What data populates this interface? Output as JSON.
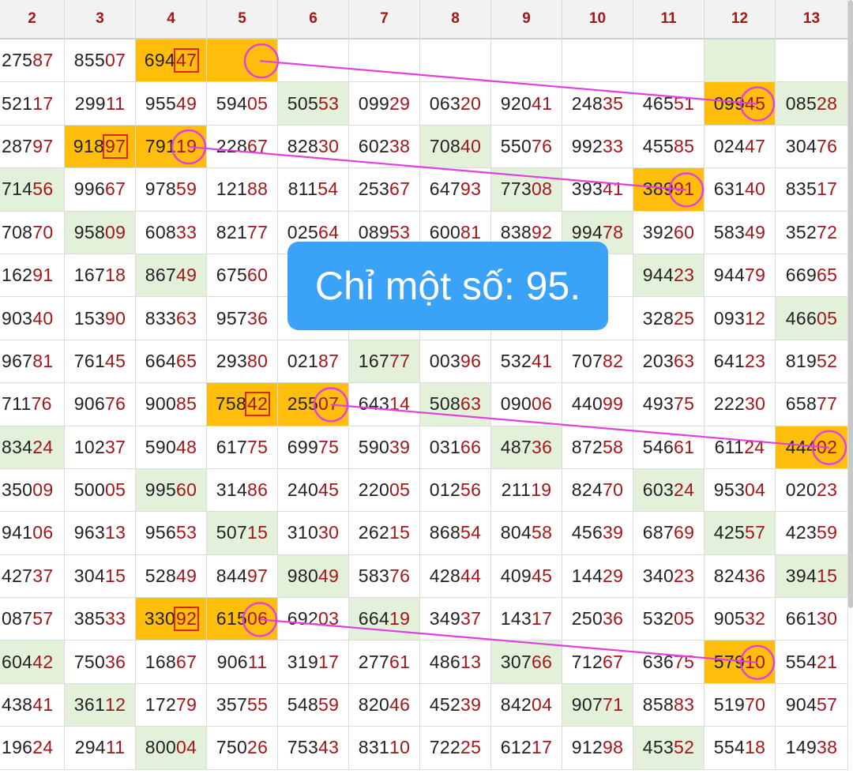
{
  "headers": [
    "2",
    "3",
    "4",
    "5",
    "6",
    "7",
    "8",
    "9",
    "10",
    "11",
    "12",
    "13"
  ],
  "rows": [
    [
      "27587",
      "85507",
      "69447",
      "",
      "",
      "",
      "",
      "",
      "",
      "",
      "",
      ""
    ],
    [
      "52117",
      "29911",
      "95549",
      "59405",
      "50553",
      "09929",
      "06320",
      "92041",
      "24835",
      "46551",
      "09945",
      "08528"
    ],
    [
      "28797",
      "91897",
      "79119",
      "22867",
      "82830",
      "60238",
      "70840",
      "55076",
      "99233",
      "45585",
      "02447",
      "30476"
    ],
    [
      "71456",
      "99667",
      "97859",
      "12188",
      "81154",
      "25367",
      "64793",
      "77308",
      "39341",
      "38991",
      "63140",
      "83517"
    ],
    [
      "70870",
      "95809",
      "60833",
      "82177",
      "02564",
      "08953",
      "60081",
      "83892",
      "99478",
      "39260",
      "58349",
      "35272"
    ],
    [
      "16291",
      "16718",
      "86749",
      "67560",
      "",
      "",
      "",
      "",
      "84",
      "94423",
      "94479",
      "66965"
    ],
    [
      "90340",
      "15390",
      "83363",
      "95736",
      "",
      "",
      "",
      "",
      "86",
      "32825",
      "09312",
      "46605"
    ],
    [
      "96781",
      "76145",
      "66465",
      "29380",
      "02187",
      "16777",
      "00396",
      "53241",
      "70782",
      "20363",
      "64123",
      "81952"
    ],
    [
      "71176",
      "90676",
      "90085",
      "75842",
      "25507",
      "64314",
      "50863",
      "09006",
      "44099",
      "49375",
      "22230",
      "65877"
    ],
    [
      "83424",
      "10237",
      "59048",
      "61775",
      "69975",
      "59039",
      "03166",
      "48736",
      "87258",
      "54661",
      "61124",
      "44402"
    ],
    [
      "35009",
      "50005",
      "99560",
      "31486",
      "24045",
      "22005",
      "01256",
      "21119",
      "82470",
      "60324",
      "95304",
      "02023"
    ],
    [
      "94106",
      "96313",
      "95653",
      "50715",
      "31030",
      "26215",
      "86854",
      "80458",
      "45639",
      "68769",
      "42557",
      "42359"
    ],
    [
      "42737",
      "30415",
      "52849",
      "84497",
      "98049",
      "58376",
      "42844",
      "40945",
      "14429",
      "34023",
      "82436",
      "39415"
    ],
    [
      "08757",
      "38533",
      "33092",
      "61506",
      "69203",
      "66419",
      "34937",
      "14317",
      "25036",
      "53205",
      "90532",
      "66130"
    ],
    [
      "60442",
      "75036",
      "16867",
      "90611",
      "31917",
      "27761",
      "48613",
      "30766",
      "71267",
      "63675",
      "57910",
      "55421"
    ],
    [
      "43841",
      "36112",
      "17279",
      "35755",
      "54859",
      "82046",
      "45239",
      "84204",
      "90771",
      "85883",
      "51970",
      "90457"
    ],
    [
      "19624",
      "29411",
      "80004",
      "75026",
      "75343",
      "83110",
      "72225",
      "61217",
      "91298",
      "45352",
      "55418",
      "14938"
    ]
  ],
  "green_cells": [
    [
      0,
      10
    ],
    [
      1,
      4
    ],
    [
      1,
      11
    ],
    [
      2,
      6
    ],
    [
      3,
      0
    ],
    [
      3,
      7
    ],
    [
      4,
      1
    ],
    [
      4,
      8
    ],
    [
      5,
      2
    ],
    [
      5,
      9
    ],
    [
      6,
      11
    ],
    [
      7,
      5
    ],
    [
      8,
      6
    ],
    [
      9,
      0
    ],
    [
      9,
      7
    ],
    [
      10,
      2
    ],
    [
      10,
      9
    ],
    [
      11,
      3
    ],
    [
      11,
      10
    ],
    [
      12,
      4
    ],
    [
      12,
      11
    ],
    [
      13,
      5
    ],
    [
      14,
      0
    ],
    [
      14,
      7
    ],
    [
      15,
      1
    ],
    [
      15,
      8
    ],
    [
      16,
      2
    ],
    [
      16,
      9
    ]
  ],
  "orange_cells": [
    [
      0,
      2
    ],
    [
      0,
      3
    ],
    [
      1,
      10
    ],
    [
      2,
      1
    ],
    [
      2,
      2
    ],
    [
      3,
      9
    ],
    [
      8,
      3
    ],
    [
      8,
      4
    ],
    [
      9,
      11
    ],
    [
      13,
      2
    ],
    [
      13,
      3
    ],
    [
      14,
      10
    ]
  ],
  "boxed_cells": [
    [
      0,
      2
    ],
    [
      2,
      1
    ],
    [
      8,
      3
    ],
    [
      13,
      2
    ]
  ],
  "circled_cells": [
    [
      0,
      3
    ],
    [
      1,
      10
    ],
    [
      2,
      2
    ],
    [
      3,
      9
    ],
    [
      8,
      4
    ],
    [
      9,
      11
    ],
    [
      13,
      3
    ],
    [
      14,
      10
    ]
  ],
  "links": [
    [
      [
        0,
        3
      ],
      [
        1,
        10
      ]
    ],
    [
      [
        2,
        2
      ],
      [
        3,
        9
      ]
    ],
    [
      [
        8,
        4
      ],
      [
        9,
        11
      ]
    ],
    [
      [
        13,
        3
      ],
      [
        14,
        10
      ]
    ]
  ],
  "callout_text": "Chỉ một số: 95.",
  "colors": {
    "green": "#e3f1da",
    "orange": "#ffbe0b",
    "accent_line": "#e040e0",
    "box_red": "#e0261b",
    "tail_red": "#a4161a",
    "callout_bg": "#3aa2f7"
  }
}
